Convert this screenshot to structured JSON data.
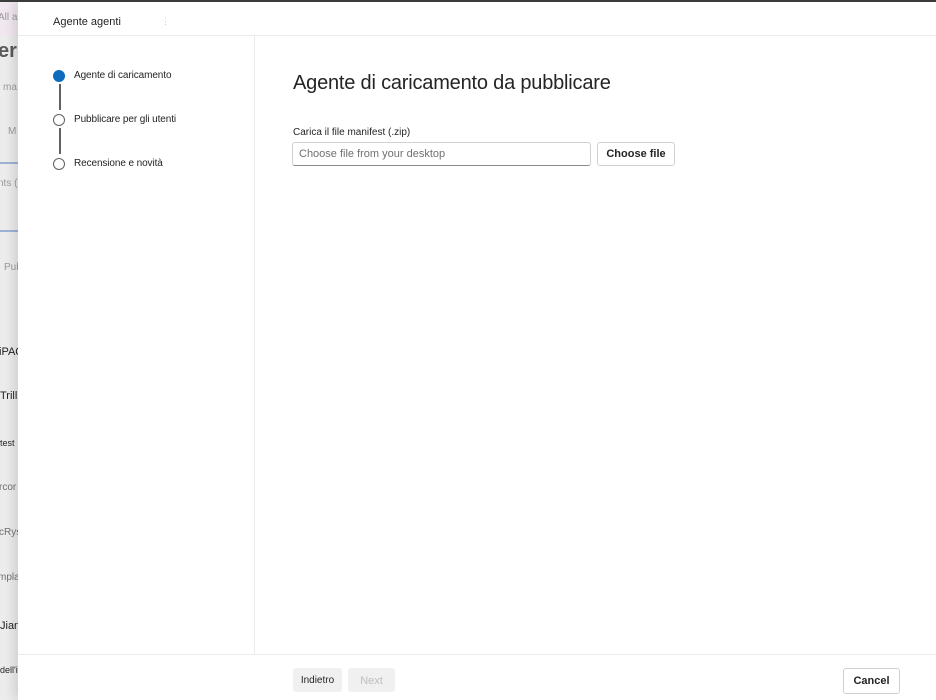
{
  "background_page": {
    "items": [
      "All a",
      "er",
      "ma",
      "M",
      "nts (",
      "Pub",
      "iPAQ",
      "Trill",
      "test",
      "rcor",
      "cRys",
      "mpla",
      "Jian",
      "dell'iride"
    ]
  },
  "dialog": {
    "title": "Agente agenti",
    "steps": [
      {
        "label": "Agente di caricamento",
        "state": "active"
      },
      {
        "label": "Pubblicare per gli utenti",
        "state": "pending"
      },
      {
        "label": "Recensione e novità",
        "state": "pending"
      }
    ],
    "content": {
      "heading": "Agente di caricamento da pubblicare",
      "field_label": "Carica il file manifest (.zip)",
      "file_input_placeholder": "Choose file from your desktop",
      "file_input_value": "",
      "choose_file_label": "Choose file"
    },
    "footer": {
      "back_label": "Indietro",
      "next_label": "Next",
      "cancel_label": "Cancel"
    }
  },
  "colors": {
    "accent": "#0f6cbd",
    "step_inactive": "#616161",
    "disabled_text": "#bdbdbd"
  }
}
